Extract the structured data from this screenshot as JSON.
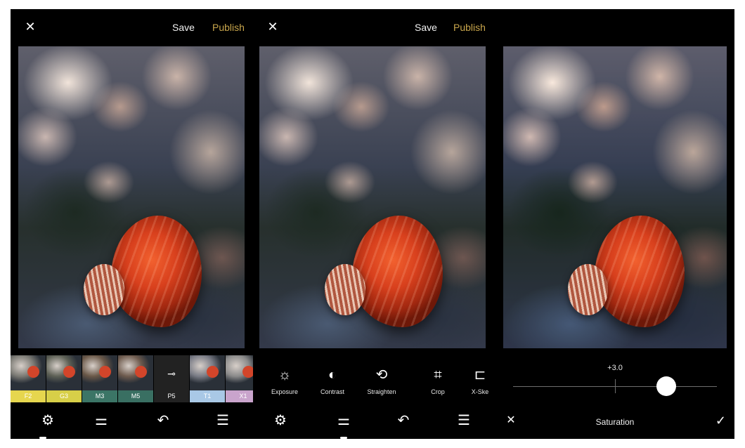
{
  "colors": {
    "background": "#000000",
    "publish_accent": "#c9a64c"
  },
  "screen1": {
    "close_icon": "close-icon",
    "save_label": "Save",
    "publish_label": "Publish",
    "filters": [
      {
        "label": "F2",
        "color": "#e6d64e",
        "thumb": "#7b7a74"
      },
      {
        "label": "G3",
        "color": "#d7cf48",
        "thumb": "#5d6055"
      },
      {
        "label": "M3",
        "color": "#3b7566",
        "thumb": "#6a5848"
      },
      {
        "label": "M5",
        "color": "#396f62",
        "thumb": "#6e5b4e"
      },
      {
        "label": "P5",
        "color": "#222222",
        "active": true
      },
      {
        "label": "T1",
        "color": "#a9c8e6",
        "thumb": "#7a7c86"
      },
      {
        "label": "X1",
        "color": "#c9a4cc",
        "thumb": "#8a8a8a"
      }
    ],
    "nav": {
      "active": 0
    }
  },
  "screen2": {
    "close_icon": "close-icon",
    "save_label": "Save",
    "publish_label": "Publish",
    "tools": [
      {
        "label": "Exposure",
        "icon": "☼"
      },
      {
        "label": "Contrast",
        "icon": "◐"
      },
      {
        "label": "Straighten",
        "icon": "⟲"
      },
      {
        "label": "Crop",
        "icon": "⌗"
      },
      {
        "label": "X-Ske",
        "icon": "⊏"
      }
    ],
    "nav": {
      "active": 1
    }
  },
  "screen3": {
    "slider_value": "+3.0",
    "slider_level": 0.75,
    "tool_name": "Saturation",
    "cancel_icon": "close-icon",
    "confirm_icon": "checkmark-icon"
  },
  "nav_icons": [
    "filters-icon",
    "adjust-icon",
    "undo-icon",
    "history-icon"
  ]
}
